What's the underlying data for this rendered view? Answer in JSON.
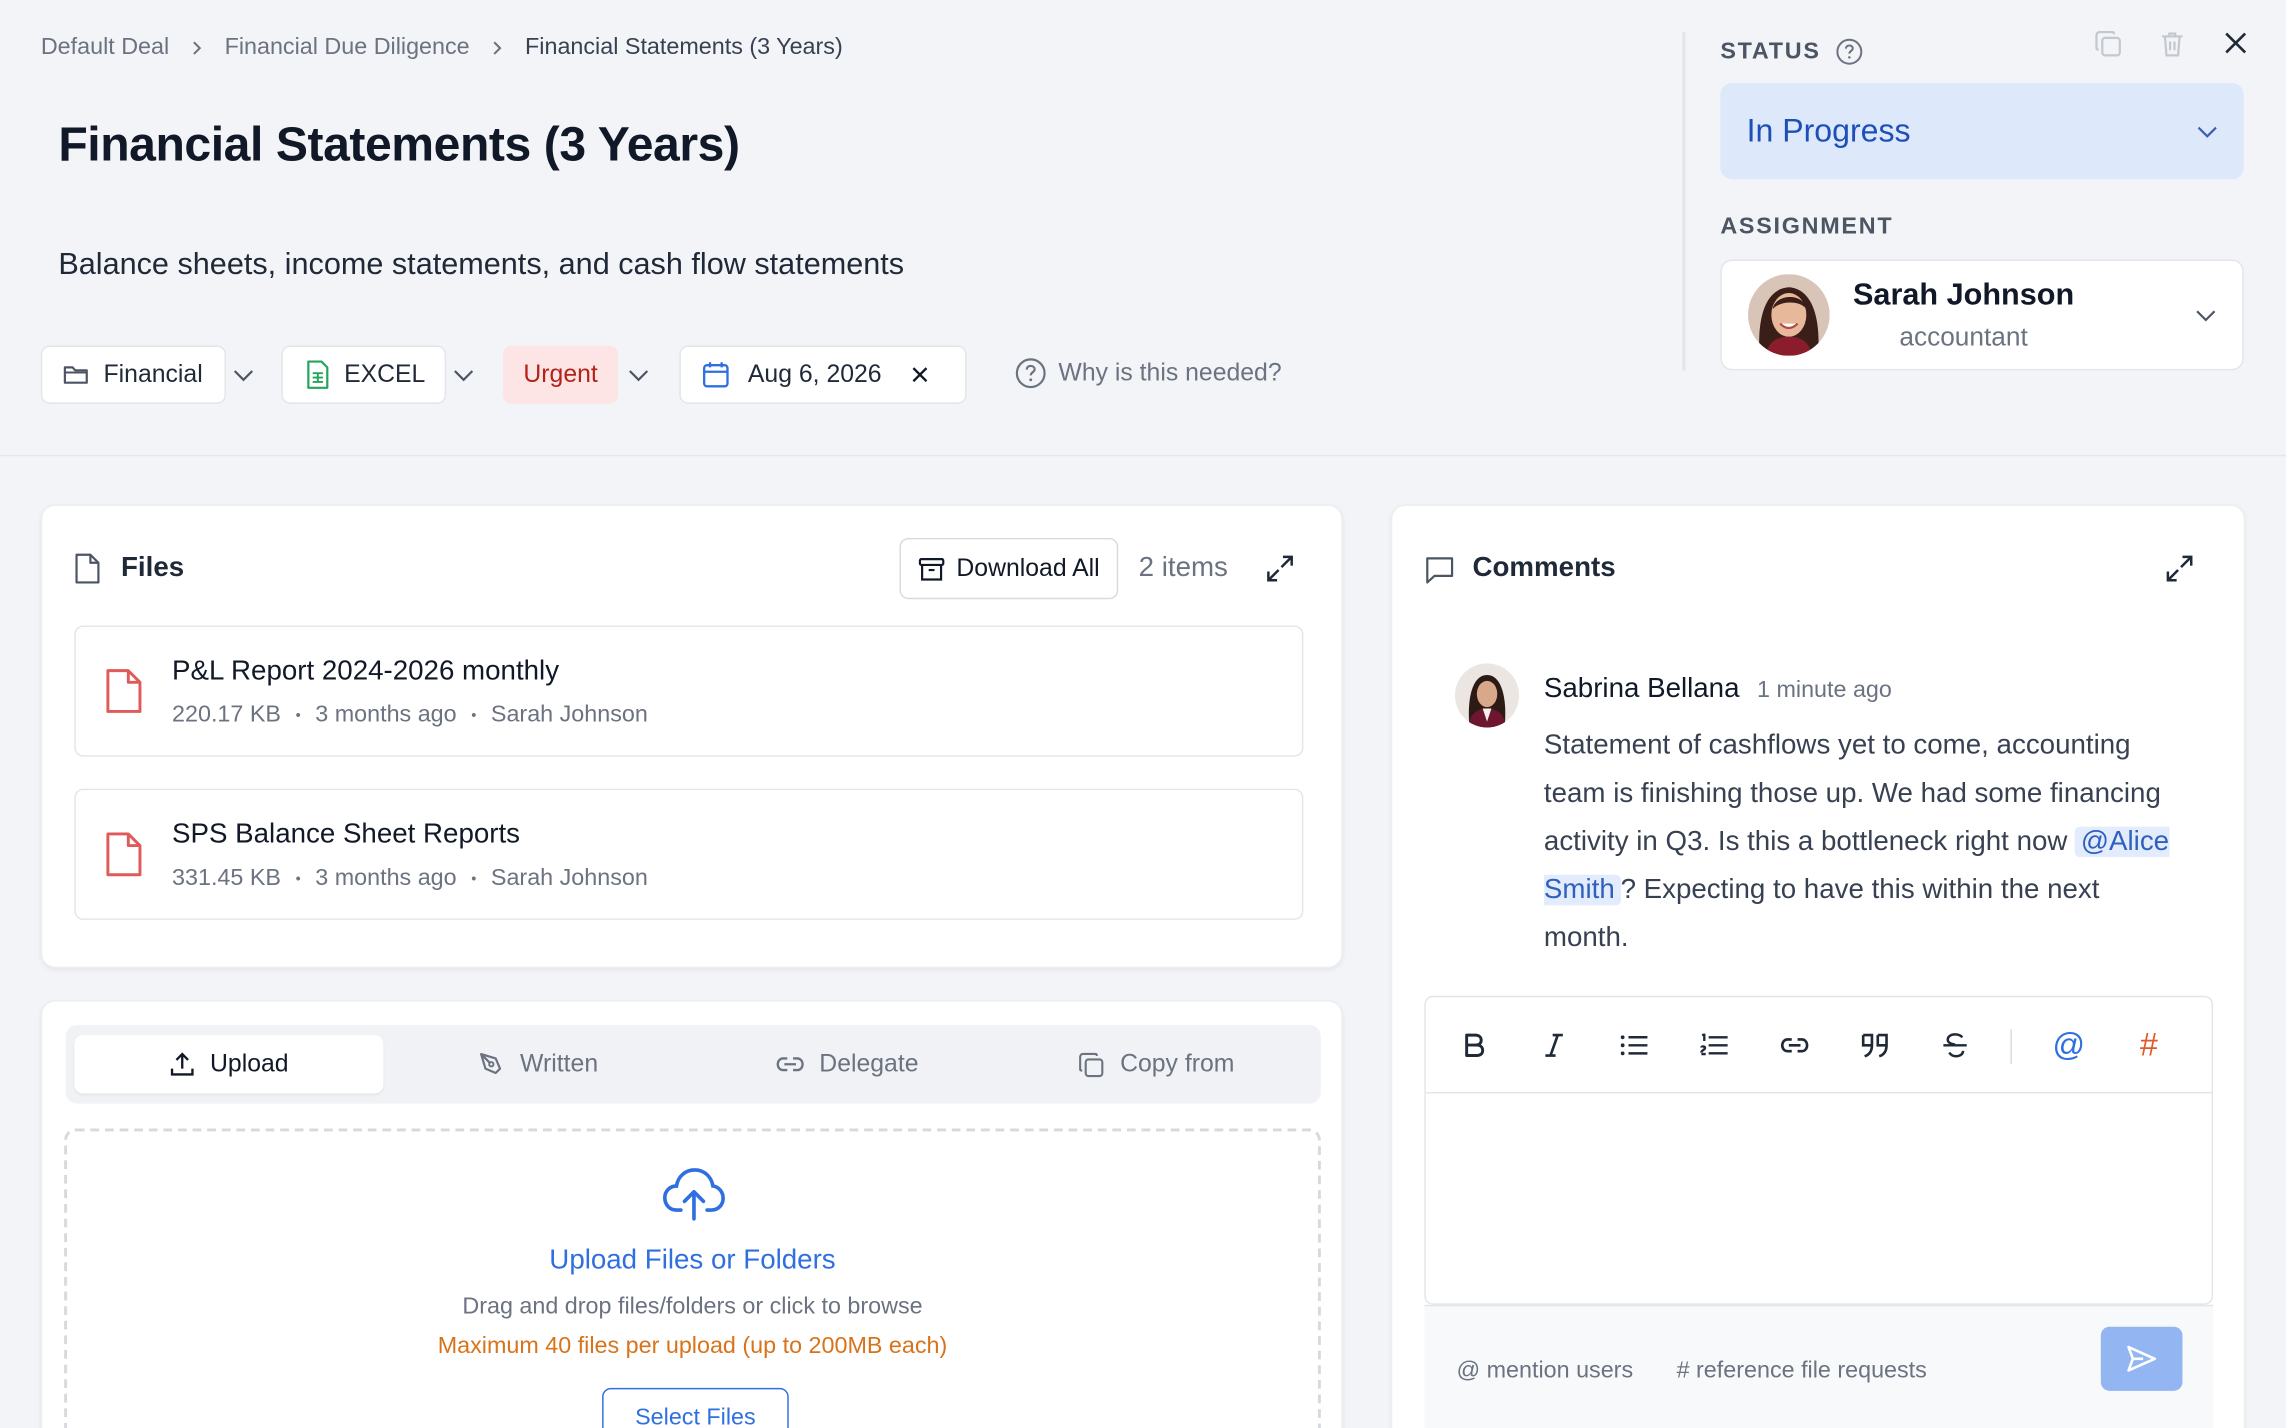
{
  "breadcrumb": {
    "items": [
      "Default Deal",
      "Financial Due Diligence",
      "Financial Statements (3 Years)"
    ]
  },
  "request": {
    "title": "Financial Statements (3 Years)",
    "description": "Balance sheets, income statements, and cash flow statements",
    "category": "Financial",
    "file_type": "EXCEL",
    "priority": "Urgent",
    "due_date": "Aug 6, 2026",
    "why_label": "Why is this needed?"
  },
  "status": {
    "label": "STATUS",
    "value": "In Progress"
  },
  "assignment": {
    "label": "ASSIGNMENT",
    "name": "Sarah Johnson",
    "role": "accountant"
  },
  "files": {
    "title": "Files",
    "download_all": "Download All",
    "count": "2 items",
    "list": [
      {
        "name": "P&L Report 2024-2026 monthly",
        "size": "220.17 KB",
        "age": "3 months ago",
        "uploader": "Sarah Johnson"
      },
      {
        "name": "SPS Balance Sheet Reports",
        "size": "331.45 KB",
        "age": "3 months ago",
        "uploader": "Sarah Johnson"
      }
    ]
  },
  "upload": {
    "tabs": [
      "Upload",
      "Written",
      "Delegate",
      "Copy from"
    ],
    "title": "Upload Files or Folders",
    "subtitle": "Drag and drop files/folders or click to browse",
    "limit": "Maximum 40 files per upload (up to 200MB each)",
    "select_button": "Select Files"
  },
  "comments": {
    "title": "Comments",
    "items": [
      {
        "author": "Sabrina Bellana",
        "time": "1 minute ago",
        "text_before": "Statement of cashflows yet to come, accounting team is finishing those up. We had some financing activity in Q3. Is this a bottleneck right now ",
        "mention": "@Alice Smith",
        "text_after": "? Expecting to have this within the next month."
      }
    ],
    "hint_mention": "@ mention users",
    "hint_reference": "# reference file requests"
  },
  "colors": {
    "accent": "#2f6fe0",
    "urgent_bg": "#fde5e5",
    "urgent_text": "#b42318",
    "status_bg": "#dde8fb",
    "warning": "#d9731b"
  }
}
